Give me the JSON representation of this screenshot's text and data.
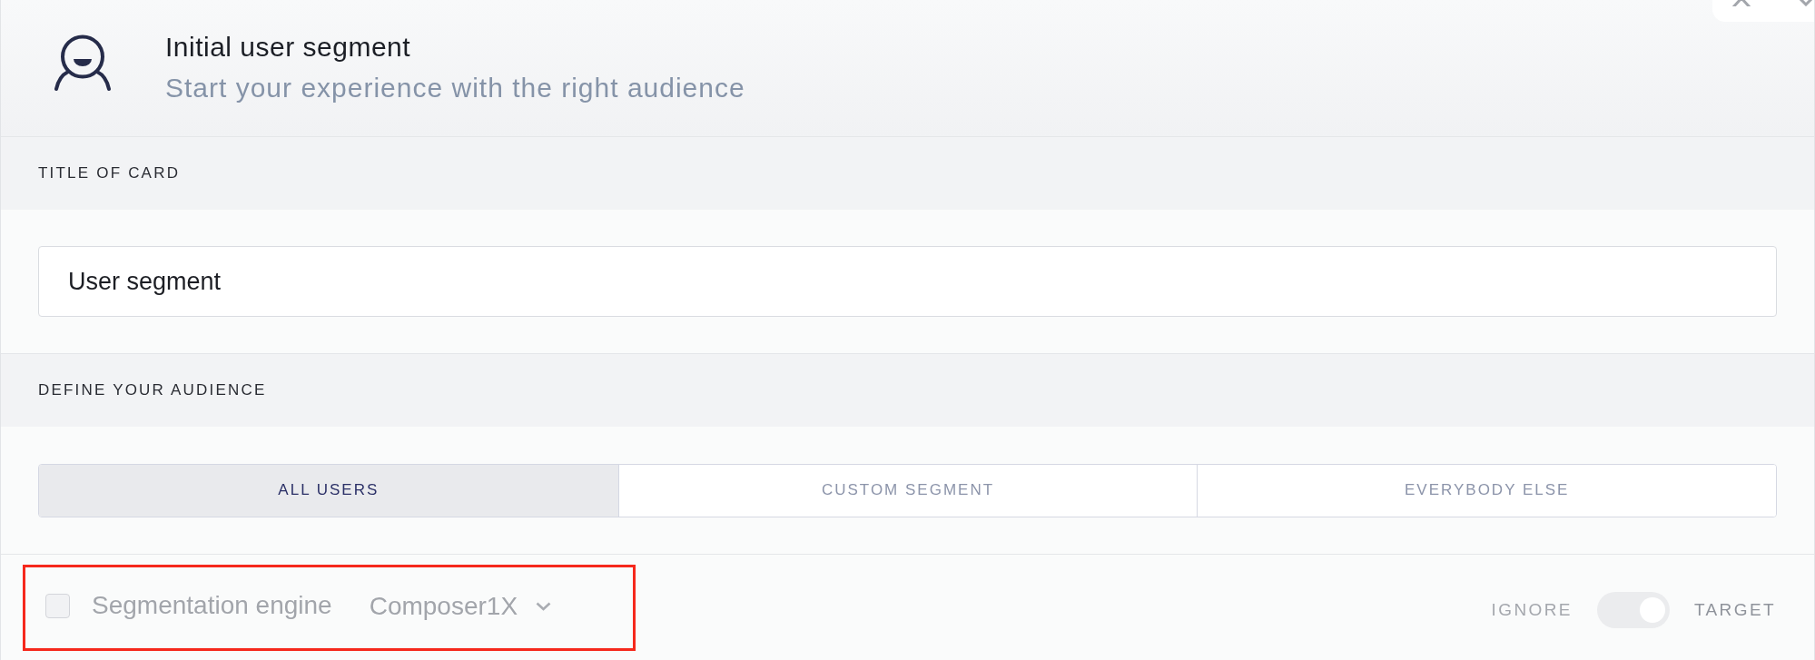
{
  "header": {
    "title": "Initial user segment",
    "subtitle": "Start your experience with the right audience"
  },
  "title_section": {
    "heading": "TITLE OF CARD",
    "input": {
      "value": "User segment"
    }
  },
  "audience_section": {
    "heading": "DEFINE YOUR AUDIENCE",
    "options": [
      {
        "label": "ALL USERS",
        "selected": true
      },
      {
        "label": "CUSTOM SEGMENT",
        "selected": false
      },
      {
        "label": "EVERYBODY ELSE",
        "selected": false
      }
    ]
  },
  "footer": {
    "engine": {
      "highlighted": true,
      "checked": false,
      "disabled": true,
      "label": "Segmentation engine",
      "value": "Composer1X"
    },
    "toggle": {
      "off_label": "IGNORE",
      "on_label": "TARGET",
      "on": true
    }
  }
}
